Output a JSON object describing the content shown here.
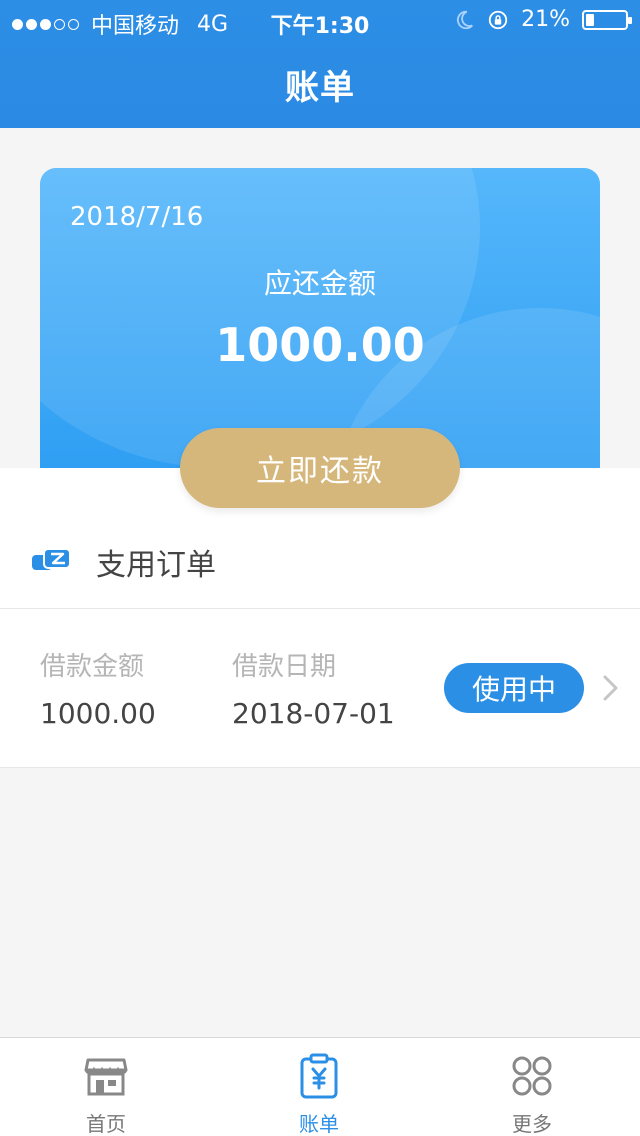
{
  "status_bar": {
    "carrier": "中国移动",
    "network": "4G",
    "time": "下午1:30",
    "battery": "21%",
    "battery_level": 0.21
  },
  "header": {
    "title": "账单"
  },
  "card": {
    "date": "2018/7/16",
    "label": "应还金额",
    "amount": "1000.00"
  },
  "repay_button": {
    "label": "立即还款"
  },
  "section": {
    "title": "支用订单",
    "icon": "card-transfer-icon"
  },
  "order": {
    "amount_label": "借款金额",
    "amount_value": "1000.00",
    "date_label": "借款日期",
    "date_value": "2018-07-01",
    "status": "使用中"
  },
  "tabs": [
    {
      "label": "首页",
      "icon": "store-icon"
    },
    {
      "label": "账单",
      "icon": "bill-yen-icon",
      "active": true
    },
    {
      "label": "更多",
      "icon": "more-circles-icon"
    }
  ],
  "colors": {
    "primary": "#2b8fe6",
    "gold": "#d6b77b",
    "card_top": "#56b7fb",
    "card_bottom": "#2f9ff3"
  }
}
